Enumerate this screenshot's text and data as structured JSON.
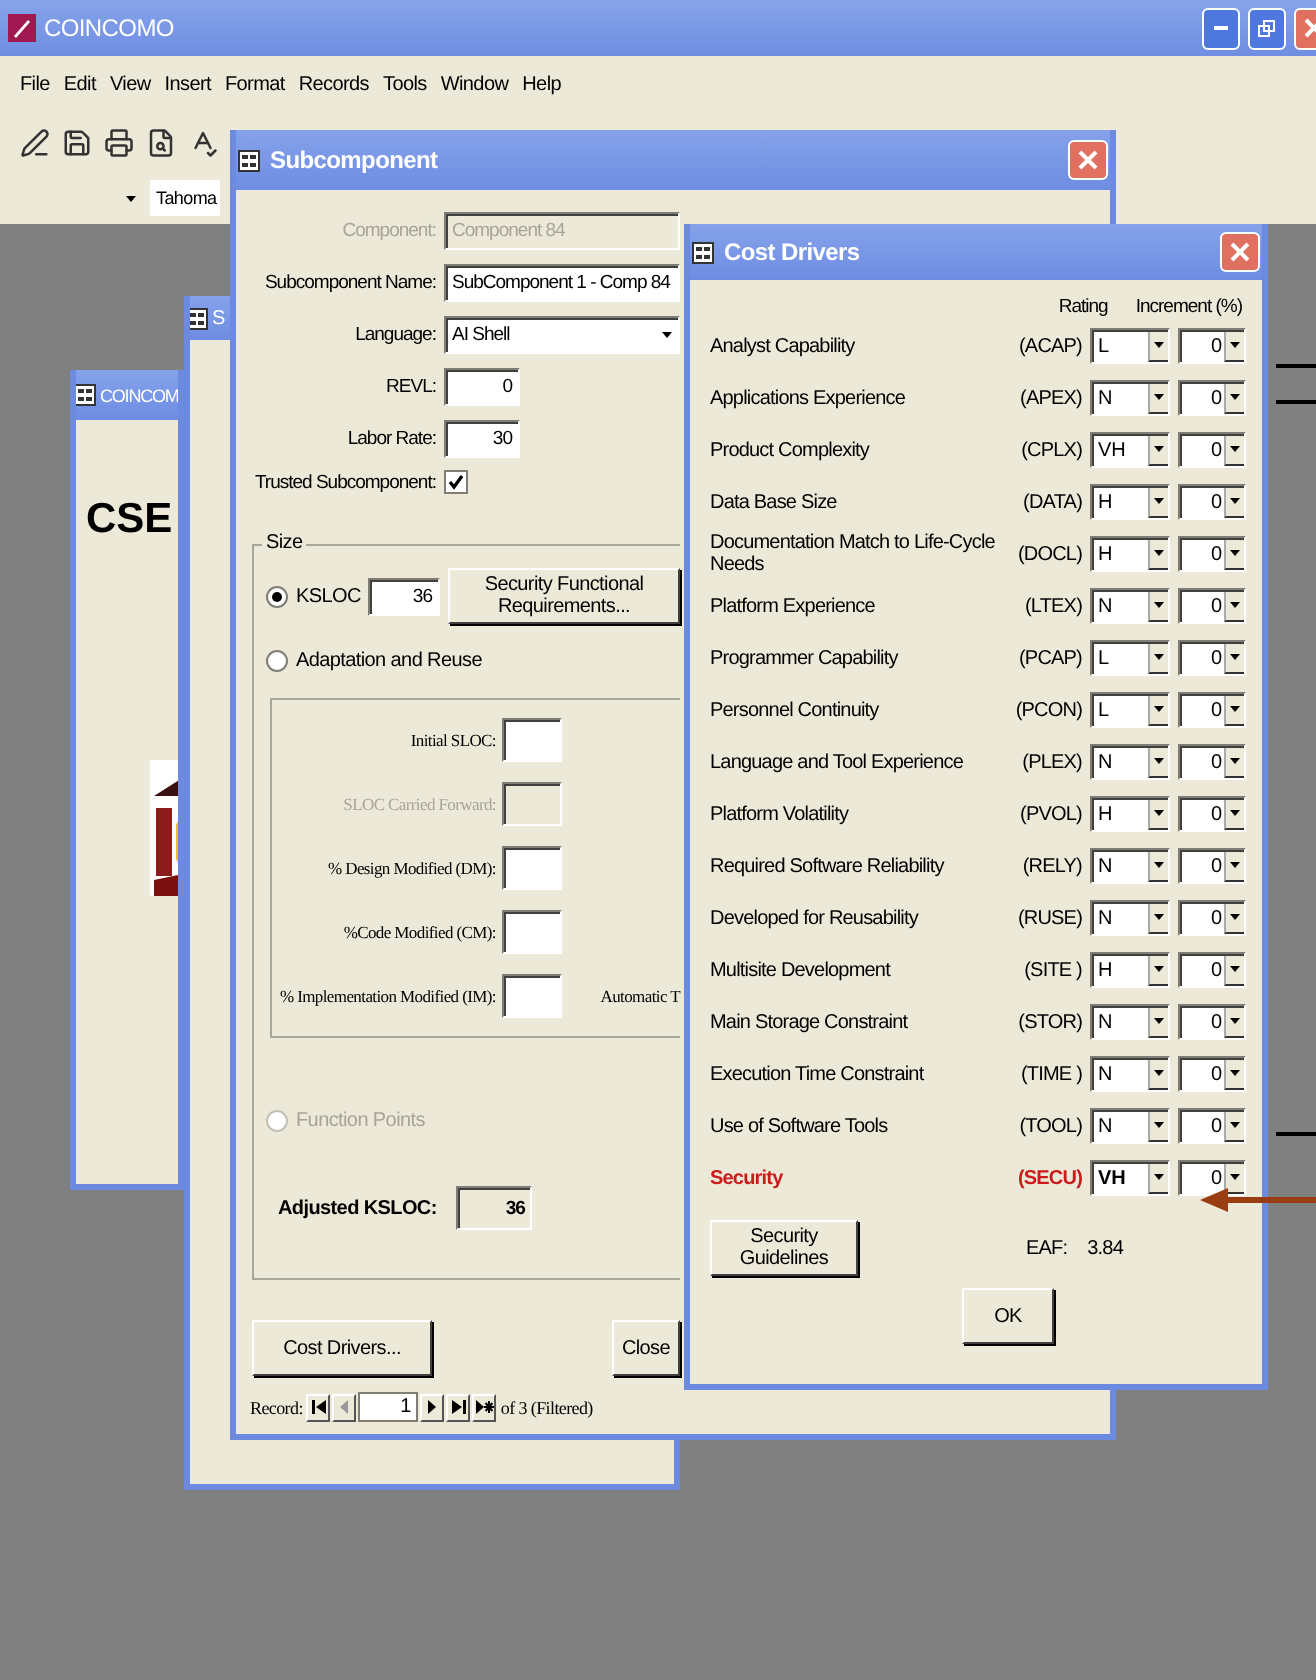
{
  "app": {
    "title": "COINCOMO",
    "menu": [
      "File",
      "Edit",
      "View",
      "Insert",
      "Format",
      "Records",
      "Tools",
      "Window",
      "Help"
    ],
    "font_box": "Tahoma"
  },
  "coincomo_window": {
    "title": "COINCOM",
    "heading": "CSE"
  },
  "second_subcomponent_window": {
    "title": "S"
  },
  "subcomponent": {
    "title": "Subcomponent",
    "fields": [
      {
        "kind": "text",
        "label": "Component:",
        "value": "Component 84",
        "disabled": true
      },
      {
        "kind": "text",
        "label": "Subcomponent Name:",
        "value": "SubComponent 1 - Comp 84",
        "disabled": false
      },
      {
        "kind": "dropdown",
        "label": "Language:",
        "value": "AI Shell",
        "disabled": false
      },
      {
        "kind": "number",
        "label": "REVL:",
        "value": "0",
        "disabled": false
      },
      {
        "kind": "number",
        "label": "Labor Rate:",
        "value": "30",
        "disabled": false
      },
      {
        "kind": "checkbox",
        "label": "Trusted Subcomponent:",
        "checked": true,
        "disabled": false
      }
    ],
    "size": {
      "label": "Size",
      "ksloc": {
        "label": "KSLOC",
        "value": "36",
        "selected": true
      },
      "sfr_button": "Security Functional Requirements...",
      "adaptation": {
        "label": "Adaptation and Reuse",
        "selected": false,
        "fields": [
          {
            "label": "Initial SLOC:",
            "disabled": false
          },
          {
            "label": "SLOC Carried Forward:",
            "disabled": true
          },
          {
            "label": "% Design Modified (DM):",
            "disabled": false
          },
          {
            "label": "%Code Modified (CM):",
            "disabled": false
          },
          {
            "label": "% Implementation Modified (IM):",
            "disabled": false
          }
        ],
        "automatic_label": "Automatic T"
      },
      "function_points": {
        "label": "Function Points",
        "selected": false,
        "disabled": true
      },
      "adjusted": {
        "label": "Adjusted KSLOC:",
        "value": "36"
      }
    },
    "buttons": [
      "Cost Drivers...",
      "Close"
    ],
    "record_nav": {
      "label": "Record:",
      "value": "1",
      "total": "of 3 (Filtered)"
    }
  },
  "cost_drivers": {
    "title": "Cost Drivers",
    "columns": [
      "Rating",
      "Increment (%)"
    ],
    "rows": [
      {
        "name": "Analyst Capability",
        "code": "(ACAP)",
        "rating": "L",
        "increment": "0",
        "highlighted": false
      },
      {
        "name": "Applications Experience",
        "code": "(APEX)",
        "rating": "N",
        "increment": "0",
        "highlighted": false
      },
      {
        "name": "Product Complexity",
        "code": "(CPLX)",
        "rating": "VH",
        "increment": "0",
        "highlighted": false
      },
      {
        "name": "Data Base Size",
        "code": "(DATA)",
        "rating": "H",
        "increment": "0",
        "highlighted": false
      },
      {
        "name": "Documentation Match to Life-Cycle Needs",
        "code": "(DOCL)",
        "rating": "H",
        "increment": "0",
        "highlighted": false
      },
      {
        "name": "Platform Experience",
        "code": "(LTEX)",
        "rating": "N",
        "increment": "0",
        "highlighted": false
      },
      {
        "name": "Programmer Capability",
        "code": "(PCAP)",
        "rating": "L",
        "increment": "0",
        "highlighted": false
      },
      {
        "name": "Personnel Continuity",
        "code": "(PCON)",
        "rating": "L",
        "increment": "0",
        "highlighted": false
      },
      {
        "name": "Language and Tool Experience",
        "code": "(PLEX)",
        "rating": "N",
        "increment": "0",
        "highlighted": false
      },
      {
        "name": "Platform Volatility",
        "code": "(PVOL)",
        "rating": "H",
        "increment": "0",
        "highlighted": false
      },
      {
        "name": "Required Software Reliability",
        "code": "(RELY)",
        "rating": "N",
        "increment": "0",
        "highlighted": false
      },
      {
        "name": "Developed for Reusability",
        "code": "(RUSE)",
        "rating": "N",
        "increment": "0",
        "highlighted": false
      },
      {
        "name": "Multisite Development",
        "code": "(SITE )",
        "rating": "H",
        "increment": "0",
        "highlighted": false
      },
      {
        "name": "Main Storage Constraint",
        "code": "(STOR)",
        "rating": "N",
        "increment": "0",
        "highlighted": false
      },
      {
        "name": "Execution Time Constraint",
        "code": "(TIME )",
        "rating": "N",
        "increment": "0",
        "highlighted": false
      },
      {
        "name": "Use of Software Tools",
        "code": "(TOOL)",
        "rating": "N",
        "increment": "0",
        "highlighted": false
      },
      {
        "name": "Security",
        "code": "(SECU)",
        "rating": "VH",
        "increment": "0",
        "highlighted": true
      }
    ],
    "guidelines_button": "Security Guidelines",
    "eaf_label": "EAF:",
    "eaf_value": "3.84",
    "ok_button": "OK"
  }
}
